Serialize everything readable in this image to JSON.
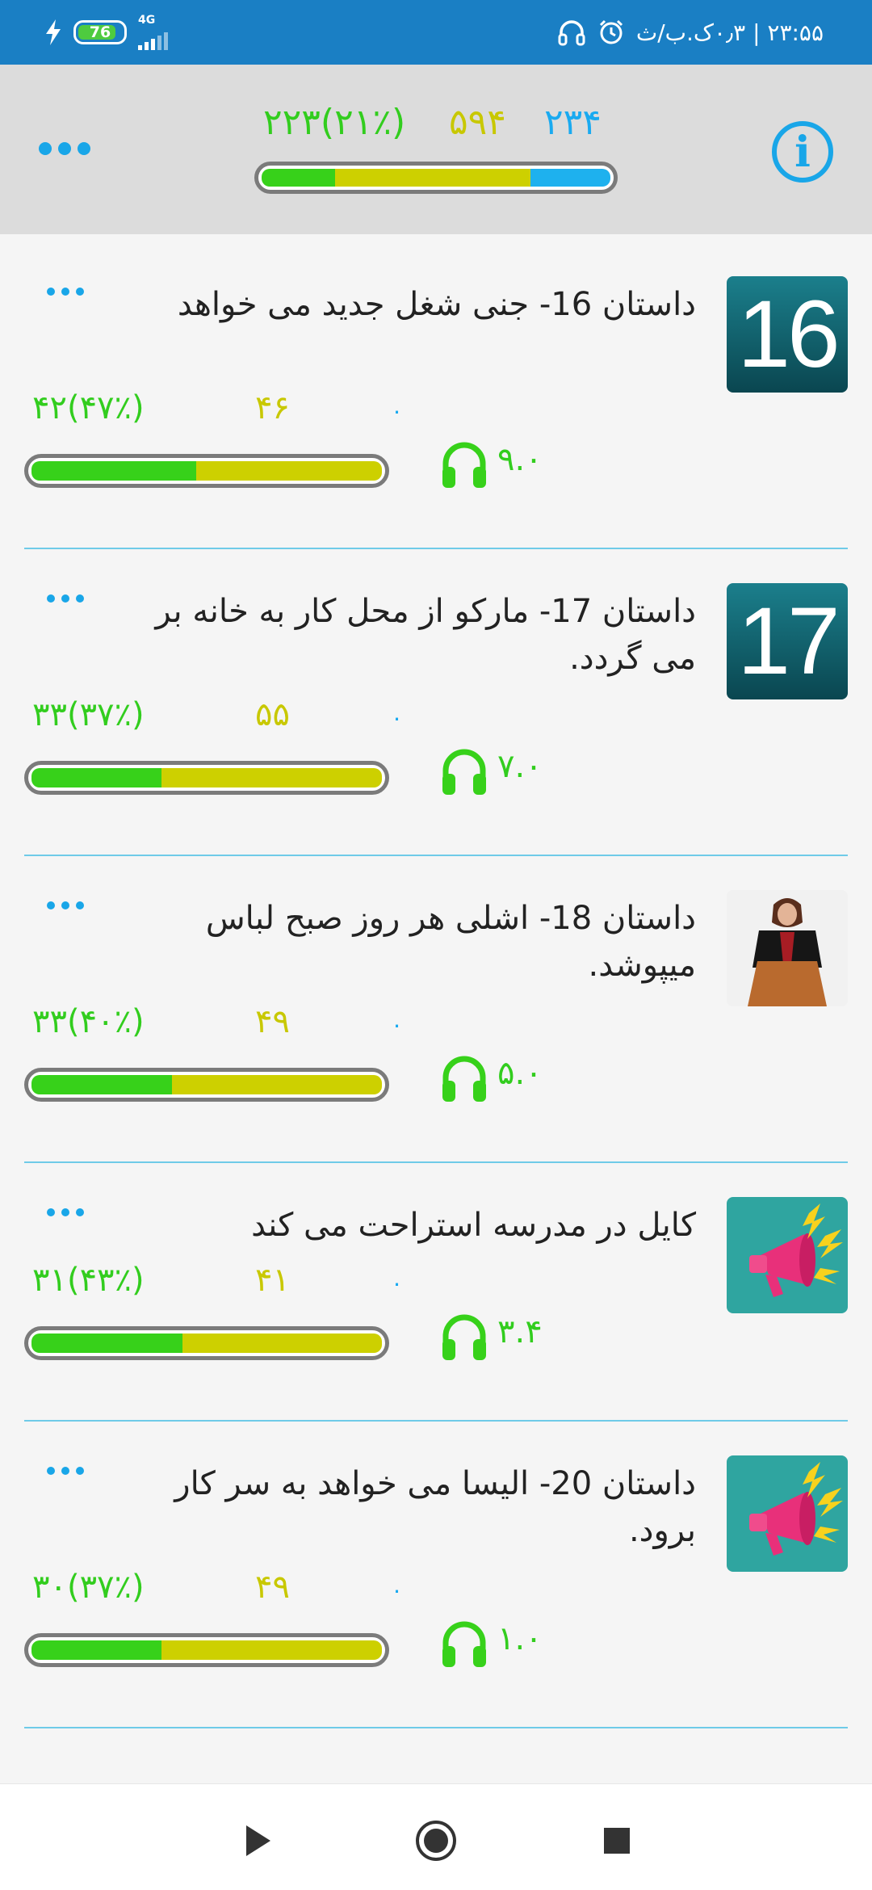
{
  "status_bar": {
    "time_text": "۲۳:۵۵ | ۰٫۳ک.ب/ث",
    "battery": "76",
    "network": "4G",
    "icons": [
      "headphones-icon",
      "alarm-icon",
      "charging-icon",
      "signal-icon"
    ]
  },
  "header": {
    "stats": {
      "completed": "۲۲۳(۲۱٪)",
      "in_progress": "۵۹۴",
      "not_started": "۲۳۴"
    },
    "progress": {
      "green": 0.21,
      "yellow": 0.56,
      "blue": 0.23
    },
    "info_label": "i"
  },
  "items": [
    {
      "thumb_type": "number",
      "thumb_text": "16",
      "title": "داستان 16- جنی شغل جدید می خواهد",
      "completed": "۴۲(۴۷٪)",
      "in_progress": "۴۶",
      "not_started": "۰",
      "duration": "۹.۰",
      "progress": {
        "green": 0.47,
        "yellow": 0.53
      }
    },
    {
      "thumb_type": "number",
      "thumb_text": "17",
      "title": "داستان 17- مارکو از محل کار به خانه بر می گردد.",
      "completed": "۳۳(۳۷٪)",
      "in_progress": "۵۵",
      "not_started": "۰",
      "duration": "۷.۰",
      "progress": {
        "green": 0.37,
        "yellow": 0.63
      }
    },
    {
      "thumb_type": "photo",
      "thumb_text": "",
      "title": "داستان 18- اشلی هر روز صبح لباس میپوشد.",
      "completed": "۳۳(۴۰٪)",
      "in_progress": "۴۹",
      "not_started": "۰",
      "duration": "۵.۰",
      "progress": {
        "green": 0.4,
        "yellow": 0.6
      }
    },
    {
      "thumb_type": "megaphone",
      "thumb_text": "",
      "title": "کایل در مدرسه استراحت می کند",
      "completed": "۳۱(۴۳٪)",
      "in_progress": "۴۱",
      "not_started": "۰",
      "duration": "۳.۴",
      "progress": {
        "green": 0.43,
        "yellow": 0.57
      }
    },
    {
      "thumb_type": "megaphone",
      "thumb_text": "",
      "title": "داستان 20- الیسا می خواهد به سر کار برود.",
      "completed": "۳۰(۳۷٪)",
      "in_progress": "۴۹",
      "not_started": "۰",
      "duration": "۱.۰",
      "progress": {
        "green": 0.37,
        "yellow": 0.63
      }
    }
  ],
  "nav": [
    "play-icon",
    "record-icon",
    "stop-icon"
  ],
  "colors": {
    "accent": "#19a6e8",
    "green": "#37d11a",
    "yellow": "#cdd000",
    "blue": "#1eb1ee",
    "status_bar": "#1a7fc4"
  }
}
